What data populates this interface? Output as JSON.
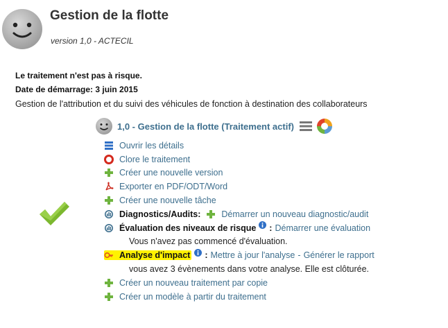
{
  "header": {
    "title": "Gestion de la flotte",
    "version": "version 1,0 - ACTECIL"
  },
  "summary": {
    "risk": "Le traitement n'est pas à risque.",
    "start_date": "Date de démarrage: 3 juin 2015",
    "description": "Gestion de l'attribution et du suivi des véhicules de fonction à destination des collaborateurs"
  },
  "treatment": {
    "title": "1,0 - Gestion de la flotte (Traitement actif)"
  },
  "actions": {
    "open_details": "Ouvrir les détails",
    "close_treatment": "Clore le traitement",
    "new_version": "Créer une nouvelle version",
    "export": "Exporter en PDF/ODT/Word",
    "new_task": "Créer une nouvelle tâche",
    "diagnostics_label": "Diagnostics/Audits:",
    "diagnostics_link": "Démarrer un nouveau diagnostic/audit",
    "risk_eval_label": "Évaluation des niveaux de risque",
    "risk_eval_link": "Démarrer une évaluation",
    "risk_eval_status": "Vous n'avez pas commencé d'évaluation.",
    "impact_label": "Analyse d'impact",
    "impact_update_link": "Mettre à jour l'analyse",
    "impact_report_link": "Générer le rapport",
    "impact_status": "vous avez 3 évènements dans votre analyse. Elle est clôturée.",
    "new_from_copy": "Créer un nouveau traitement par copie",
    "new_model": "Créer un modèle à partir du traitement",
    "colon": ":",
    "dash": "-"
  },
  "icons": {
    "avatar": "smiley-face-icon",
    "status": "check-mark-icon",
    "menu": "hamburger-menu-icon",
    "chart": "color-ring-icon",
    "details": "list-icon",
    "close": "close-circle-icon",
    "plus": "plus-icon",
    "pdf": "pdf-icon",
    "diagnostics": "gauge-icon",
    "info": "info-icon",
    "impact": "key-icon"
  },
  "colors": {
    "link": "#3e6f8e",
    "highlight": "#fff200",
    "check": "#7cb82f",
    "plus": "#6fb43f",
    "close": "#d42a1e",
    "details": "#2f6fc6"
  }
}
